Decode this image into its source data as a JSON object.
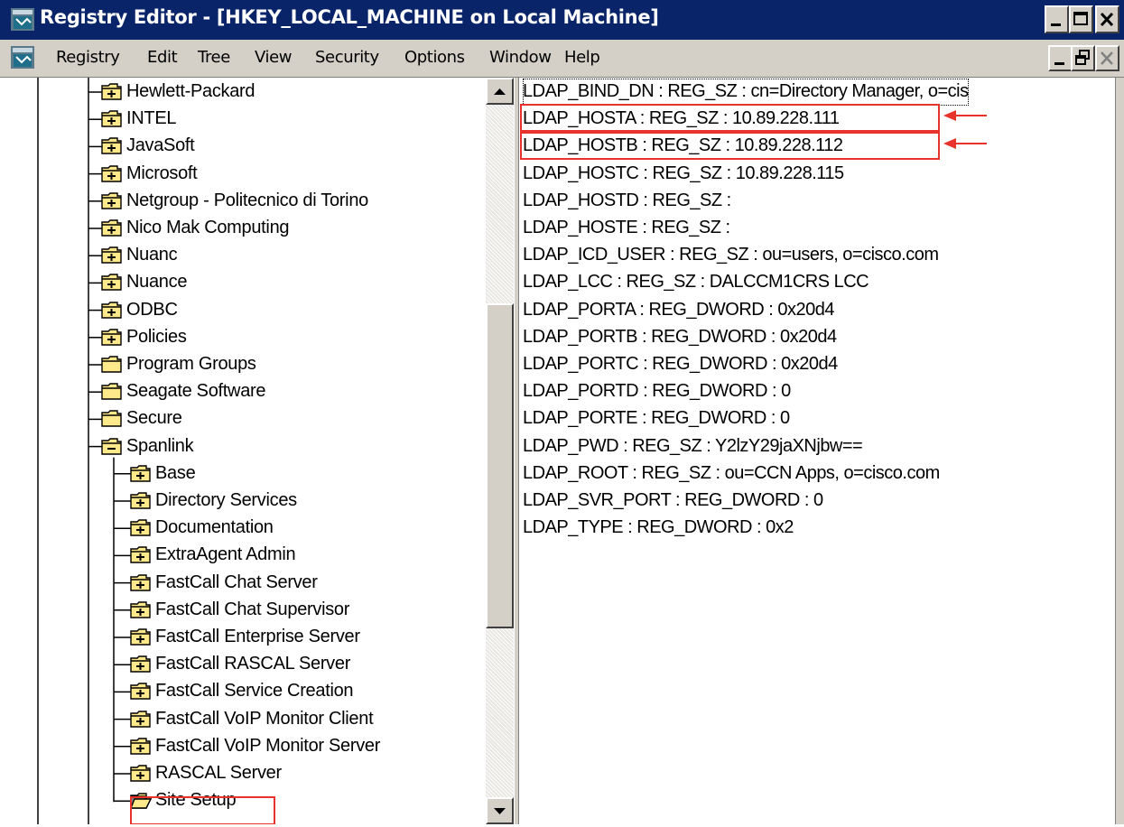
{
  "window": {
    "title": "Registry Editor - [HKEY_LOCAL_MACHINE on Local Machine]"
  },
  "menu": {
    "items": [
      "Registry",
      "Edit",
      "Tree",
      "View",
      "Security",
      "Options",
      "Window",
      "Help"
    ]
  },
  "tree": {
    "nodes": [
      {
        "label": "Hewlett-Packard",
        "level": 1,
        "expandable": true
      },
      {
        "label": "INTEL",
        "level": 1,
        "expandable": true
      },
      {
        "label": "JavaSoft",
        "level": 1,
        "expandable": true
      },
      {
        "label": "Microsoft",
        "level": 1,
        "expandable": true
      },
      {
        "label": "Netgroup - Politecnico di Torino",
        "level": 1,
        "expandable": true
      },
      {
        "label": "Nico Mak Computing",
        "level": 1,
        "expandable": true
      },
      {
        "label": "Nuanc",
        "level": 1,
        "expandable": true
      },
      {
        "label": "Nuance",
        "level": 1,
        "expandable": true
      },
      {
        "label": "ODBC",
        "level": 1,
        "expandable": true
      },
      {
        "label": "Policies",
        "level": 1,
        "expandable": true
      },
      {
        "label": "Program Groups",
        "level": 1,
        "expandable": false
      },
      {
        "label": "Seagate Software",
        "level": 1,
        "expandable": false
      },
      {
        "label": "Secure",
        "level": 1,
        "expandable": false
      },
      {
        "label": "Spanlink",
        "level": 1,
        "expandable": true,
        "expanded": true
      },
      {
        "label": "Base",
        "level": 2,
        "expandable": true
      },
      {
        "label": "Directory Services",
        "level": 2,
        "expandable": true
      },
      {
        "label": "Documentation",
        "level": 2,
        "expandable": true
      },
      {
        "label": "ExtraAgent Admin",
        "level": 2,
        "expandable": true
      },
      {
        "label": "FastCall Chat Server",
        "level": 2,
        "expandable": true
      },
      {
        "label": "FastCall Chat Supervisor",
        "level": 2,
        "expandable": true
      },
      {
        "label": "FastCall Enterprise Server",
        "level": 2,
        "expandable": true
      },
      {
        "label": "FastCall RASCAL Server",
        "level": 2,
        "expandable": true
      },
      {
        "label": "FastCall Service Creation",
        "level": 2,
        "expandable": true
      },
      {
        "label": "FastCall VoIP Monitor Client",
        "level": 2,
        "expandable": true
      },
      {
        "label": "FastCall VoIP Monitor Server",
        "level": 2,
        "expandable": true
      },
      {
        "label": "RASCAL Server",
        "level": 2,
        "expandable": true
      },
      {
        "label": "Site Setup",
        "level": 2,
        "expandable": false,
        "open": true,
        "selected": true
      }
    ]
  },
  "values": {
    "entries": [
      "LDAP_BIND_DN : REG_SZ : cn=Directory Manager, o=cis",
      "LDAP_HOSTA : REG_SZ : 10.89.228.111",
      "LDAP_HOSTB : REG_SZ : 10.89.228.112",
      "LDAP_HOSTC : REG_SZ : 10.89.228.115",
      "LDAP_HOSTD : REG_SZ :",
      "LDAP_HOSTE : REG_SZ :",
      "LDAP_ICD_USER : REG_SZ : ou=users, o=cisco.com",
      "LDAP_LCC : REG_SZ : DALCCM1CRS LCC",
      "LDAP_PORTA : REG_DWORD : 0x20d4",
      "LDAP_PORTB : REG_DWORD : 0x20d4",
      "LDAP_PORTC : REG_DWORD : 0x20d4",
      "LDAP_PORTD : REG_DWORD : 0",
      "LDAP_PORTE : REG_DWORD : 0",
      "LDAP_PWD : REG_SZ : Y2lzY29jaXNjbw==",
      "LDAP_ROOT : REG_SZ : ou=CCN Apps, o=cisco.com",
      "LDAP_SVR_PORT : REG_DWORD : 0",
      "LDAP_TYPE : REG_DWORD : 0x2"
    ],
    "highlighted_indices": [
      1,
      2
    ]
  },
  "colors": {
    "titlebar": "#0a246a",
    "chrome": "#d4d0c8",
    "annotation": "#e8322c",
    "folder": "#ffe98a"
  }
}
